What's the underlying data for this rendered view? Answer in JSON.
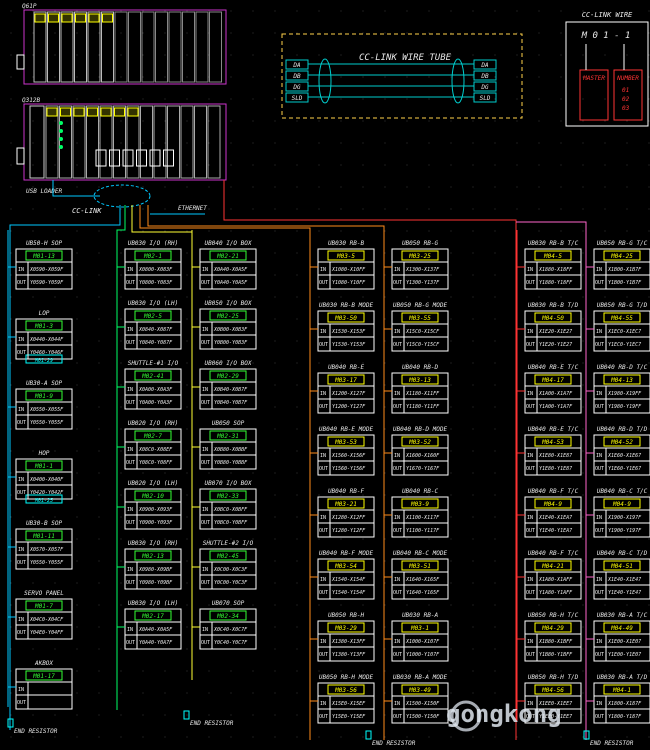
{
  "colors": {
    "bg": "#000000",
    "title": "#ffffff",
    "label": "#e8e8e8",
    "box": "#ffffff",
    "station": "#33ff33",
    "station_yellow": "#ffff00",
    "station_cyan": "#00ffff",
    "wire_cyan": "#00c8ff",
    "wire_green": "#00ff66",
    "wire_yellow": "#ffff33",
    "wire_orange": "#ff8c1a",
    "wire_pink": "#ff66cc",
    "wire_red": "#ff3333",
    "rack": "#cc33cc",
    "tube": "#ffd24a",
    "tube_signal": "#00cccc"
  },
  "plc": {
    "rack1_label": "Q61P",
    "rack2_label": "Q312B",
    "usb_label": "USB LOADER",
    "ethernet_label": "ETHERNET",
    "cclink_label": "CC-LINK"
  },
  "wire_tube": {
    "title": "CC-LINK WIRE TUBE",
    "signals": [
      "DA",
      "DB",
      "DG",
      "SLD"
    ]
  },
  "cc_wire": {
    "title": "CC-LINK WIRE",
    "code": "M 0 1 - 1",
    "master_label": "MASTER",
    "number_label": "NUMBER",
    "numbers": [
      "01",
      "02",
      "03"
    ]
  },
  "end_resistors": [
    {
      "label": "END RESISTOR"
    },
    {
      "label": "END RESISTOR"
    },
    {
      "label": "END RESISTOR"
    },
    {
      "label": "END RESISTOR"
    }
  ],
  "logo": {
    "text": "gongkong"
  },
  "columns": [
    {
      "modules": [
        {
          "title": "UB50-H SOP",
          "station": "M01-13",
          "in": "X0590-X059F",
          "out": "Y0590-Y059F"
        },
        {
          "title": "LOP",
          "station": "M01-3",
          "in": "X0440-X044F",
          "out": "Y0460-Y046F",
          "extra": "M01-29"
        },
        {
          "title": "UB30-A SOP",
          "station": "M01-9",
          "in": "X0550-X055F",
          "out": "Y0550-Y055F"
        },
        {
          "title": "HOP",
          "station": "M01-1",
          "in": "X0400-X040F",
          "out": "Y0420-Y042F",
          "extra": "M01-25"
        },
        {
          "title": "UB30-B SOP",
          "station": "M01-11",
          "in": "X0570-X057F",
          "out": "Y0550-Y055F"
        },
        {
          "title": "SERVO PANEL",
          "station": "M01-7",
          "in": "X04C0-X04CF",
          "out": "Y04E0-Y04FF"
        },
        {
          "title": "AKBOX",
          "station": "M01-17",
          "in": "",
          "out": ""
        }
      ]
    },
    {
      "modules": [
        {
          "title": "UB030 I/O (RH)",
          "station": "M02-1",
          "in": "X0800-X083F",
          "out": "Y0800-Y083F"
        },
        {
          "title": "UB030 I/O (LH)",
          "station": "M02-5",
          "in": "X0840-X087F",
          "out": "Y0840-Y087F"
        },
        {
          "title": "SHUTTLE-#1 I/O",
          "station": "M02-41",
          "in": "X0A00-X0A3F",
          "out": "Y0A00-Y0A3F"
        },
        {
          "title": "UB020 I/O (RH)",
          "station": "M02-7",
          "in": "X08C0-X08EF",
          "out": "Y08C0-Y08FF"
        },
        {
          "title": "UB020 I/O (LH)",
          "station": "M02-10",
          "in": "X0900-X093F",
          "out": "Y0900-Y093F"
        },
        {
          "title": "UB030 I/O (RH)",
          "station": "M02-13",
          "in": "X0980-X09BF",
          "out": "Y0980-Y09BF"
        },
        {
          "title": "UB030 I/O (LH)",
          "station": "M02-17",
          "in": "X0A40-X0A5F",
          "out": "Y0A40-Y0A7F"
        }
      ]
    },
    {
      "modules": [
        {
          "title": "UB040 I/O BOX",
          "station": "M02-21",
          "in": "X0A40-X0A5F",
          "out": "Y0A40-Y0A5F"
        },
        {
          "title": "UB050 I/O BOX",
          "station": "M02-25",
          "in": "X0B00-X0B3F",
          "out": "Y0B00-Y0B3F"
        },
        {
          "title": "UB060 I/O BOX",
          "station": "M02-29",
          "in": "X0B40-X0B7F",
          "out": "Y0B40-Y0B7F"
        },
        {
          "title": "UB050 SOP",
          "station": "M02-31",
          "in": "X0B80-X0BBF",
          "out": "Y0B80-Y0BBF"
        },
        {
          "title": "UB070 I/O BOX",
          "station": "M02-33",
          "in": "X0BC0-X0BFF",
          "out": "Y0BC0-Y0BFF"
        },
        {
          "title": "SHUTTLE-#2 I/O",
          "station": "M02-45",
          "in": "X0C00-X0C3F",
          "out": "Y0C00-Y0C3F"
        },
        {
          "title": "UB070 SOP",
          "station": "M02-34",
          "in": "X0C40-X0C7F",
          "out": "Y0C40-Y0C7F"
        }
      ]
    },
    {
      "modules": [
        {
          "title": "UB030 RB-B",
          "station": "M03-5",
          "in": "X1080-X10FF",
          "out": "Y1080-Y10FF"
        },
        {
          "title": "UB030 RB-B MODE",
          "station": "M03-50",
          "in": "X1530-X153F",
          "out": "Y1530-Y153F"
        },
        {
          "title": "UB040 RB-E",
          "station": "M03-17",
          "in": "X1200-X127F",
          "out": "Y1200-Y127F"
        },
        {
          "title": "UB040 RB-E MODE",
          "station": "M03-53",
          "in": "X1560-X156F",
          "out": "Y1560-Y156F"
        },
        {
          "title": "UB040 RB-F",
          "station": "M03-21",
          "in": "X1280-X12FF",
          "out": "Y1280-Y12FF"
        },
        {
          "title": "UB040 RB-F MODE",
          "station": "M03-54",
          "in": "X1540-X154F",
          "out": "Y1540-Y154F"
        },
        {
          "title": "UB050 RB-H",
          "station": "M03-29",
          "in": "X1380-X13FF",
          "out": "Y1380-Y13FF"
        },
        {
          "title": "UB050 RB-H MODE",
          "station": "M03-56",
          "in": "X15E0-X15EF",
          "out": "Y15E0-Y15EF"
        }
      ]
    },
    {
      "modules": [
        {
          "title": "UB050 RB-G",
          "station": "M03-25",
          "in": "X1300-X137F",
          "out": "Y1300-Y137F"
        },
        {
          "title": "UB050 RB-G MODE",
          "station": "M03-55",
          "in": "X15C0-X15CF",
          "out": "Y15C0-Y15CF"
        },
        {
          "title": "UB040 RB-D",
          "station": "M03-13",
          "in": "X1180-X11FF",
          "out": "Y1180-Y11FF"
        },
        {
          "title": "UB040 RB-D MODE",
          "station": "M03-52",
          "in": "X1600-X160F",
          "out": "Y1670-Y167F"
        },
        {
          "title": "UB040 RB-C",
          "station": "M03-9",
          "in": "X1100-X117F",
          "out": "Y1100-Y117F"
        },
        {
          "title": "UB040 RB-C MODE",
          "station": "M03-51",
          "in": "X1640-X165F",
          "out": "Y1640-Y165F"
        },
        {
          "title": "UB030 RB-A",
          "station": "M03-1",
          "in": "X1000-X107F",
          "out": "Y1000-Y107F"
        },
        {
          "title": "UB030 RB-A MODE",
          "station": "M03-49",
          "in": "X1500-X150F",
          "out": "Y1500-Y150F"
        }
      ]
    },
    {
      "modules": [
        {
          "title": "UB030 RB-B T/C",
          "station": "M04-5",
          "in": "X1880-X18FF",
          "out": "Y1880-Y18FF"
        },
        {
          "title": "UB030 RB-B T/D",
          "station": "M04-50",
          "in": "X1E20-X1E27",
          "out": "Y1E20-Y1E27"
        },
        {
          "title": "UB040 RB-E T/C",
          "station": "M04-17",
          "in": "X1A00-X1A7F",
          "out": "Y1A00-Y1A7F"
        },
        {
          "title": "UB040 RB-E T/C",
          "station": "M04-53",
          "in": "X1E80-X1E87",
          "out": "Y1E80-Y1E87"
        },
        {
          "title": "UB040 RB-F T/C",
          "station": "M04-9",
          "in": "X1E40-X1EA7",
          "out": "Y1E40-Y1EA7"
        },
        {
          "title": "UB040 RB-F T/C",
          "station": "M04-21",
          "in": "X1A80-X1AFF",
          "out": "Y1A80-Y1AFF"
        },
        {
          "title": "UB050 RB-H T/C",
          "station": "M04-29",
          "in": "X1B80-X1BFF",
          "out": "Y1B80-Y1BFF"
        },
        {
          "title": "UB050 RB-H T/D",
          "station": "M04-56",
          "in": "X1EE0-X1EE7",
          "out": "Y1EE0-Y1EE7"
        }
      ]
    },
    {
      "modules": [
        {
          "title": "UB050 RB-G T/C",
          "station": "M04-25",
          "in": "X1B00-X1B7F",
          "out": "Y1B00-Y1B7F"
        },
        {
          "title": "UB050 RB-G T/D",
          "station": "M04-55",
          "in": "X1EC0-X1EC7",
          "out": "Y1EC0-Y1EC7"
        },
        {
          "title": "UB040 RB-D T/C",
          "station": "M04-13",
          "in": "X1980-X19FF",
          "out": "Y1980-Y19FF"
        },
        {
          "title": "UB040 RB-D T/D",
          "station": "M04-52",
          "in": "X1E60-X1E67",
          "out": "Y1E60-Y1E67"
        },
        {
          "title": "UB040 RB-C T/C",
          "station": "M04-9",
          "in": "X1900-X197F",
          "out": "Y1900-Y197F"
        },
        {
          "title": "UB040 RB-C T/D",
          "station": "M04-51",
          "in": "X1E40-X1E47",
          "out": "Y1E40-Y1E47"
        },
        {
          "title": "UB030 RB-A T/C",
          "station": "M04-49",
          "in": "X1E00-X1E07",
          "out": "Y1E00-Y1E07"
        },
        {
          "title": "UB030 RB-A T/D",
          "station": "M04-1",
          "in": "X1800-X187F",
          "out": "Y1800-Y187F"
        }
      ]
    }
  ]
}
